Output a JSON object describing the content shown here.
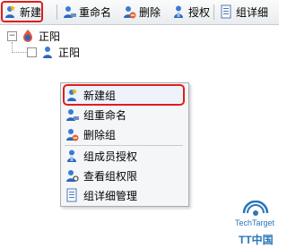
{
  "toolbar": {
    "new": "新建",
    "rename": "重命名",
    "delete": "删除",
    "authorize": "授权",
    "details": "组详细"
  },
  "tree": {
    "root_label": "正阳",
    "child_label": "正阳"
  },
  "context_menu": {
    "items": [
      "新建组",
      "组重命名",
      "删除组",
      "组成员授权",
      "查看组权限",
      "组详细管理"
    ]
  },
  "watermark": {
    "line1": "TechTarget",
    "line2": "TT中国"
  },
  "icons": {
    "user": "user-icon",
    "lock": "lock-icon",
    "doc": "document-icon"
  },
  "colors": {
    "highlight": "#e11d1d",
    "toolbar": "#e9ecef",
    "menu": "#f5f6f8"
  }
}
